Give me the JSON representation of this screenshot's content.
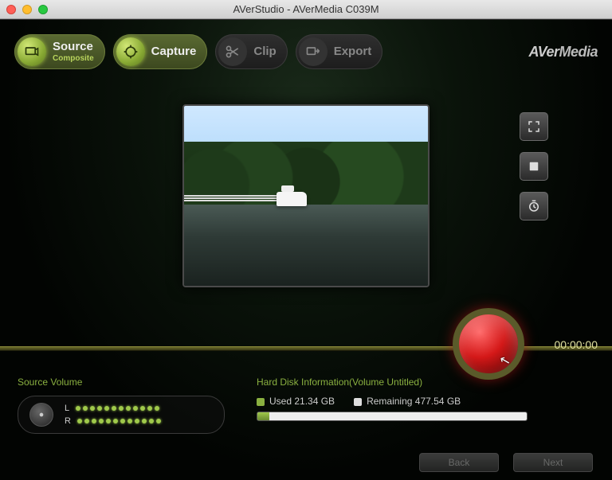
{
  "window": {
    "title": "AVerStudio - AVerMedia C039M"
  },
  "brand": {
    "prefix": "AVer",
    "suffix": "Media"
  },
  "nav": {
    "source": {
      "label": "Source",
      "sub": "Composite"
    },
    "capture": {
      "label": "Capture"
    },
    "clip": {
      "label": "Clip"
    },
    "export": {
      "label": "Export"
    }
  },
  "sidetools": {
    "fullscreen": "Fullscreen",
    "snapshot": "Snapshot",
    "timer": "Timer"
  },
  "record": {
    "timecode": "00:00:00"
  },
  "volume": {
    "title": "Source Volume",
    "left": "L",
    "right": "R",
    "level": 12
  },
  "disk": {
    "title": "Hard Disk Information(Volume Untitled)",
    "used_label": "Used",
    "used_value": "21.34 GB",
    "remaining_label": "Remaining",
    "remaining_value": "477.54 GB",
    "used_pct": 4.3
  },
  "footer": {
    "back": "Back",
    "next": "Next"
  }
}
